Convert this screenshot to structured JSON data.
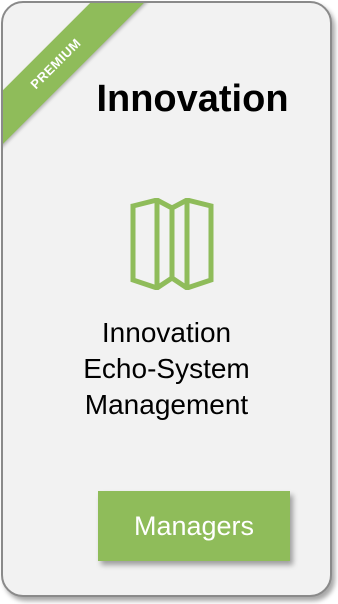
{
  "card": {
    "badge": "PREMIUM",
    "title": "Innovation",
    "icon": "map-icon",
    "description_lines": [
      "Innovation",
      "Echo-System",
      "Management"
    ],
    "button_label": "Managers"
  },
  "colors": {
    "accent": "#8fbc5a",
    "card_background": "#f2f2f2",
    "card_border": "#8a8a8a"
  }
}
